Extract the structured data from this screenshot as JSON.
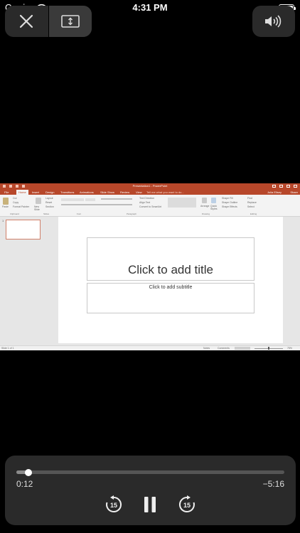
{
  "status_bar": {
    "carrier": "Carrier",
    "time": "4:31 PM"
  },
  "controls": {
    "close_icon": "close-icon",
    "screen_icon": "screen-mode-icon",
    "volume_icon": "volume-icon"
  },
  "ppt": {
    "window_title": "Presentation1 - PowerPoint",
    "tabs": [
      "File",
      "Home",
      "Insert",
      "Design",
      "Transitions",
      "Animations",
      "Slide Show",
      "Review",
      "View"
    ],
    "tell_me": "Tell me what you want to do...",
    "user": "Julia Ellsey",
    "share": "Share",
    "ribbon": {
      "paste": "Paste",
      "cut": "Cut",
      "copy": "Copy",
      "format_painter": "Format Painter",
      "clipboard": "Clipboard",
      "new_slide": "New Slide",
      "layout": "Layout",
      "reset": "Reset",
      "section": "Section",
      "slides": "Slides",
      "font": "Font",
      "paragraph": "Paragraph",
      "text_direction": "Text Direction",
      "align_text": "Align Text",
      "convert_smartart": "Convert to SmartArt",
      "arrange": "Arrange",
      "quick_styles": "Quick Styles",
      "shape_fill": "Shape Fill",
      "shape_outline": "Shape Outline",
      "shape_effects": "Shape Effects",
      "drawing": "Drawing",
      "find": "Find",
      "replace": "Replace",
      "select": "Select",
      "editing": "Editing"
    },
    "slide_number": "1",
    "title_placeholder": "Click to add title",
    "subtitle_placeholder": "Click to add subtitle",
    "status_left": "Slide 1 of 1",
    "notes": "Notes",
    "comments": "Comments",
    "zoom": "75%"
  },
  "player": {
    "elapsed": "0:12",
    "remaining": "−5:16",
    "progress_fraction": 0.045,
    "skip_back": "15",
    "skip_forward": "15"
  }
}
